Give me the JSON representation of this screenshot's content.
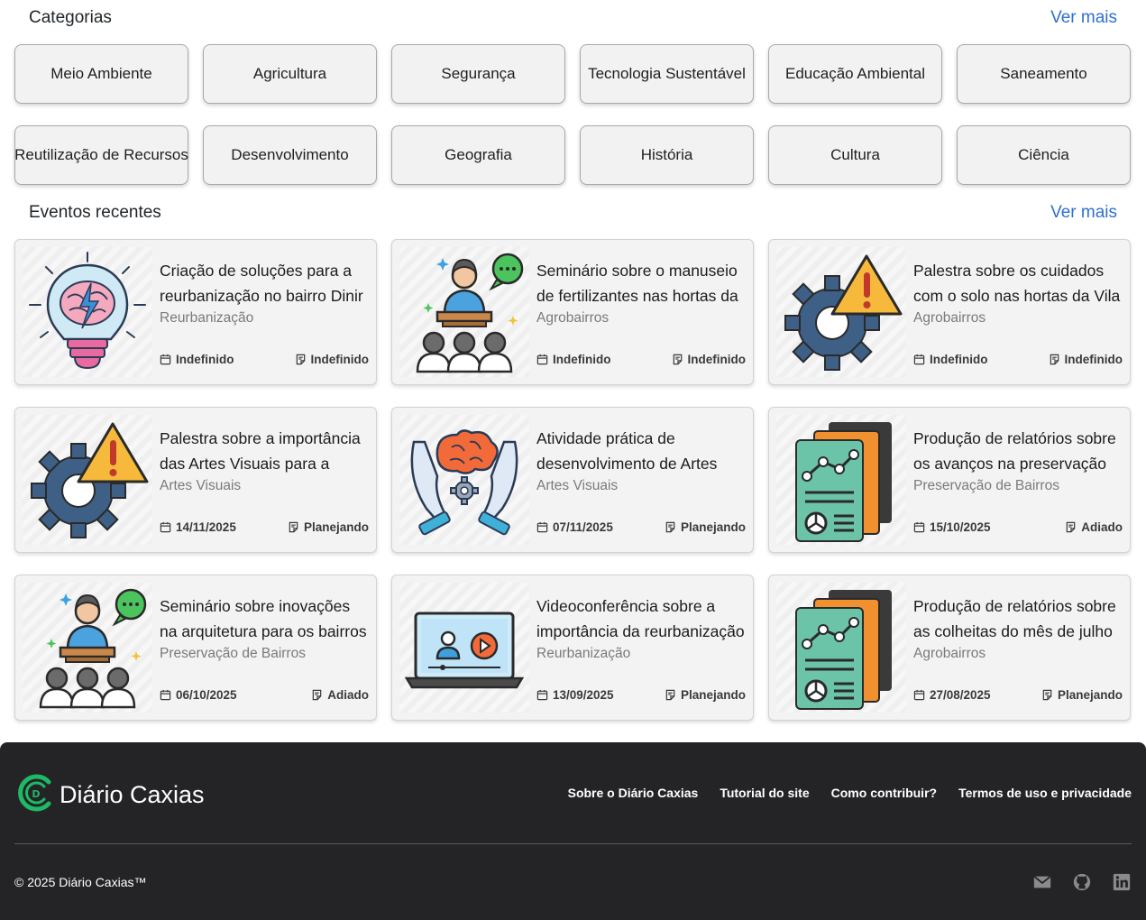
{
  "categories_section": {
    "title": "Categorias",
    "more_label": "Ver mais"
  },
  "categories": [
    "Meio Ambiente",
    "Agricultura",
    "Segurança",
    "Tecnologia Sustentável",
    "Educação Ambiental",
    "Saneamento",
    "Reutilização de Recursos",
    "Desenvolvimento",
    "Geografia",
    "História",
    "Cultura",
    "Ciência"
  ],
  "events_section": {
    "title": "Eventos recentes",
    "more_label": "Ver mais"
  },
  "events": [
    {
      "title": "Criação de soluções para a reurbanização no bairro Dinir",
      "category": "Reurbanização",
      "date": "Indefinido",
      "status": "Indefinido",
      "icon": "lightbulb-brain-icon"
    },
    {
      "title": "Seminário sobre o manuseio de fertilizantes nas hortas da",
      "category": "Agrobairros",
      "date": "Indefinido",
      "status": "Indefinido",
      "icon": "seminar-speaker-icon"
    },
    {
      "title": "Palestra sobre os cuidados com o solo nas hortas da Vila",
      "category": "Agrobairros",
      "date": "Indefinido",
      "status": "Indefinido",
      "icon": "gear-warning-icon"
    },
    {
      "title": "Palestra sobre a importância das Artes Visuais para a",
      "category": "Artes Visuais",
      "date": "14/11/2025",
      "status": "Planejando",
      "icon": "gear-warning-icon"
    },
    {
      "title": "Atividade prática de desenvolvimento de Artes",
      "category": "Artes Visuais",
      "date": "07/11/2025",
      "status": "Planejando",
      "icon": "hands-brain-icon"
    },
    {
      "title": "Produção de relatórios sobre os avanços na preservação de",
      "category": "Preservação de Bairros",
      "date": "15/10/2025",
      "status": "Adiado",
      "icon": "report-chart-icon"
    },
    {
      "title": "Seminário sobre inovações na arquitetura para os bairros",
      "category": "Preservação de Bairros",
      "date": "06/10/2025",
      "status": "Adiado",
      "icon": "seminar-speaker-icon"
    },
    {
      "title": "Videoconferência sobre a importância da reurbanização",
      "category": "Reurbanização",
      "date": "13/09/2025",
      "status": "Planejando",
      "icon": "laptop-video-icon"
    },
    {
      "title": "Produção de relatórios sobre as colheitas do mês de julho",
      "category": "Agrobairros",
      "date": "27/08/2025",
      "status": "Planejando",
      "icon": "report-chart-icon"
    }
  ],
  "footer": {
    "brand": "Diário Caxias",
    "links": [
      "Sobre o Diário Caxias",
      "Tutorial do site",
      "Como contribuir?",
      "Termos de uso e privacidade"
    ],
    "copyright": "© 2025 Diário Caxias™",
    "social_icons": [
      "email-icon",
      "github-icon",
      "linkedin-icon"
    ]
  },
  "colors": {
    "link": "#2f6fd1",
    "footer_bg": "#242426",
    "brand_green": "#1fb866"
  }
}
